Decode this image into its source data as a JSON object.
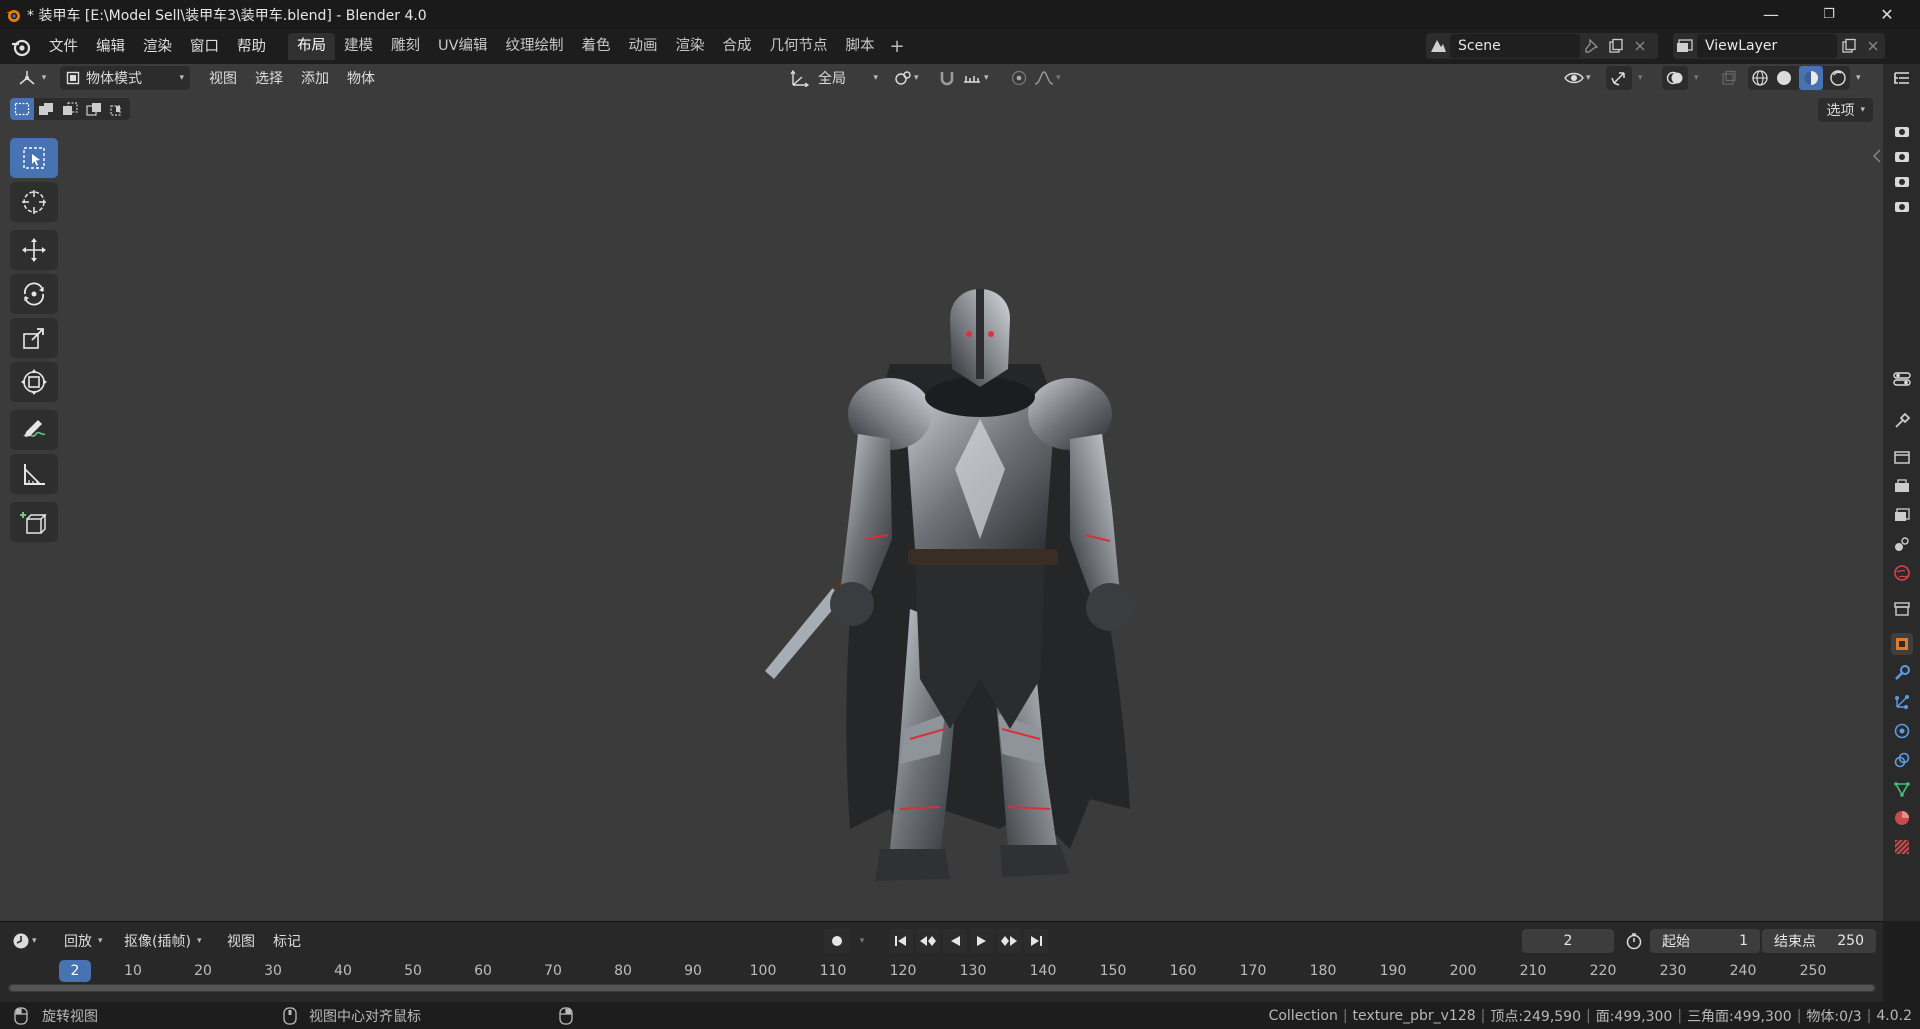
{
  "window": {
    "title": "* 装甲车 [E:\\Model Sell\\装甲车3\\装甲车.blend] - Blender 4.0",
    "minimize": "—",
    "maximize": "❐",
    "close": "✕"
  },
  "menubar": {
    "items": [
      "文件",
      "编辑",
      "渲染",
      "窗口",
      "帮助"
    ]
  },
  "workspaces": {
    "tabs": [
      "布局",
      "建模",
      "雕刻",
      "UV编辑",
      "纹理绘制",
      "着色",
      "动画",
      "渲染",
      "合成",
      "几何节点",
      "脚本"
    ],
    "active": "布局",
    "add": "+"
  },
  "scene": {
    "name": "Scene"
  },
  "view_layer": {
    "name": "ViewLayer"
  },
  "viewport": {
    "mode": "物体模式",
    "menu": [
      "视图",
      "选择",
      "添加",
      "物体"
    ],
    "orientation": "全局",
    "options": "选项"
  },
  "timeline": {
    "playback": "回放",
    "keying": "抠像(插帧)",
    "menu": [
      "视图",
      "标记"
    ],
    "current_frame": "2",
    "start_label": "起始",
    "start_value": "1",
    "end_label": "结束点",
    "end_value": "250",
    "ruler": [
      "10",
      "20",
      "30",
      "40",
      "50",
      "60",
      "70",
      "80",
      "90",
      "100",
      "110",
      "120",
      "130",
      "140",
      "150",
      "160",
      "170",
      "180",
      "190",
      "200",
      "210",
      "220",
      "230",
      "240",
      "250"
    ]
  },
  "statusbar": {
    "left_hint": "旋转视图",
    "mid_hint": "视图中心对齐鼠标",
    "collection": "Collection",
    "object": "texture_pbr_v128",
    "verts": "顶点:249,590",
    "faces": "面:499,300",
    "tris": "三角面:499,300",
    "objects": "物体:0/3",
    "version": "4.0.2"
  },
  "colors": {
    "accent": "#4772b3",
    "viewport_bg": "#3b3b3b",
    "header_bg": "#1d1d1d"
  }
}
